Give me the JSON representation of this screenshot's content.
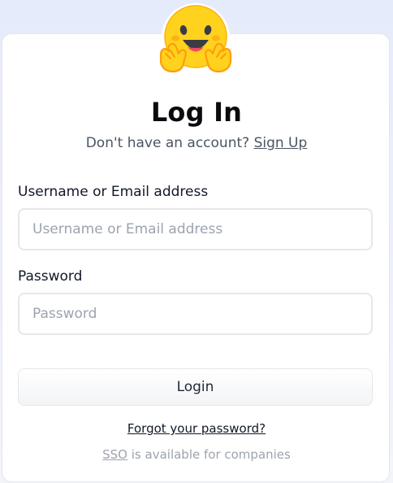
{
  "logo": {
    "icon": "hugging-face-icon"
  },
  "header": {
    "title": "Log In",
    "subtitle_prefix": "Don't have an account?",
    "signup_link": "Sign Up"
  },
  "form": {
    "username_label": "Username or Email address",
    "username_placeholder": "Username or Email address",
    "username_value": "",
    "password_label": "Password",
    "password_placeholder": "Password",
    "password_value": "",
    "login_button": "Login"
  },
  "footer": {
    "forgot_link": "Forgot your password?",
    "sso_link": "SSO",
    "sso_suffix": "is available for companies"
  },
  "colors": {
    "background": "#e6ebfb",
    "card": "#ffffff",
    "text": "#111827",
    "muted": "#9ca3af",
    "logo_yellow": "#ffd21e",
    "logo_orange": "#ff9d0b"
  }
}
